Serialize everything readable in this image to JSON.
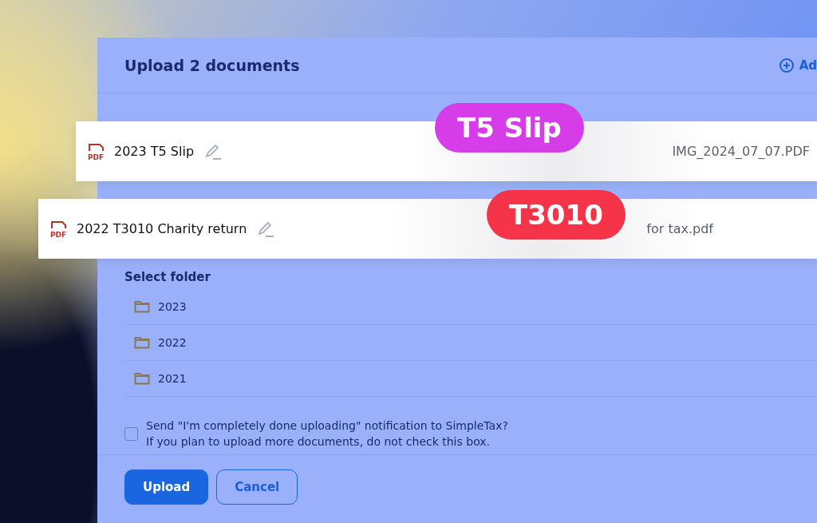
{
  "dialog": {
    "title": "Upload 2 documents",
    "add_link": "Ad"
  },
  "documents": [
    {
      "icon_label": "PDF",
      "name": "2023 T5 Slip",
      "file": "IMG_2024_07_07.PDF",
      "tag": "T5 Slip",
      "color": "#d63de8"
    },
    {
      "icon_label": "PDF",
      "name": "2022 T3010 Charity return",
      "file": "for tax.pdf",
      "tag": "T3010",
      "color": "#f5344a"
    }
  ],
  "folder_section": {
    "label": "Select folder",
    "folders": [
      {
        "name": "2023"
      },
      {
        "name": "2022"
      },
      {
        "name": "2021"
      }
    ]
  },
  "confirm": {
    "checked": false,
    "line_1": "Send \"I'm completely done uploading\" notification to SimpleTax?",
    "line_2": "If you plan to upload more documents, do not check this box."
  },
  "buttons": [
    {
      "label": "Upload",
      "kind": "primary"
    },
    {
      "label": "Cancel",
      "kind": "secondary"
    }
  ]
}
